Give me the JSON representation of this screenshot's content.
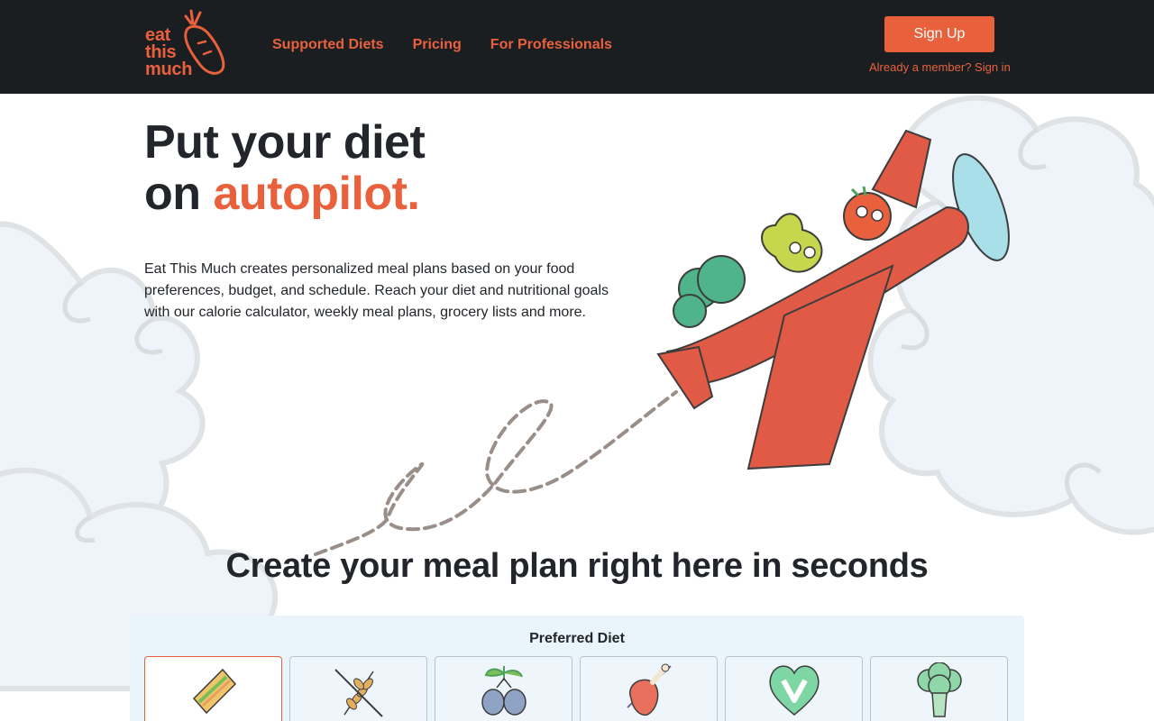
{
  "brand": {
    "logo_lines": [
      "eat",
      "this",
      "much"
    ],
    "accent_color": "#e8613c",
    "header_bg": "#1b1e21"
  },
  "nav": {
    "links": [
      "Supported Diets",
      "Pricing",
      "For Professionals"
    ]
  },
  "auth": {
    "signup_label": "Sign Up",
    "signin_text": "Already a member? Sign in"
  },
  "hero": {
    "title_line1": "Put your diet",
    "title_line2_prefix": "on ",
    "title_accent": "autopilot.",
    "description": "Eat This Much creates personalized meal plans based on your food preferences, budget, and schedule. Reach your diet and nutritional goals with our calorie calculator, weekly meal plans, grocery lists and more."
  },
  "meal_plan": {
    "title": "Create your meal plan right here in seconds",
    "diet_label": "Preferred Diet",
    "diet_options": [
      {
        "icon": "sandwich-icon",
        "selected": true
      },
      {
        "icon": "no-grain-icon",
        "selected": false
      },
      {
        "icon": "olives-icon",
        "selected": false
      },
      {
        "icon": "meat-icon",
        "selected": false
      },
      {
        "icon": "vegan-heart-icon",
        "selected": false
      },
      {
        "icon": "broccoli-icon",
        "selected": false
      }
    ]
  }
}
